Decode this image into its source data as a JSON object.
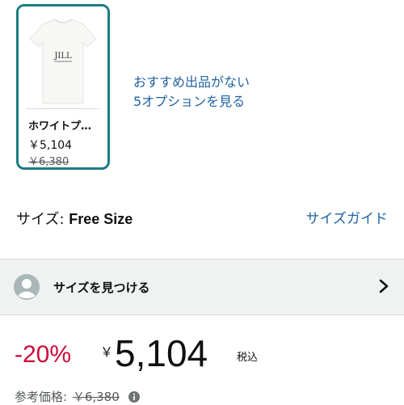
{
  "swatch": {
    "logo_text": "JILL",
    "title": "ホワイトプ…",
    "price": "￥5,104",
    "list_price": "￥6,380"
  },
  "more_options": {
    "line1": "おすすめ出品がない",
    "line2": "5オプションを見る"
  },
  "size": {
    "label": "サイズ: ",
    "value": "Free Size",
    "guide_link": "サイズガイド"
  },
  "size_finder": {
    "label": "サイズを見つける",
    "icon": "avatar-icon",
    "chevron": "chevron-right-icon"
  },
  "price": {
    "discount": "-20%",
    "currency": "￥",
    "amount": "5,104",
    "tax_note": "税込"
  },
  "reference": {
    "label": "参考価格: ",
    "price": "￥6,380",
    "icon": "info-icon"
  },
  "colors": {
    "accent_teal": "#1b7d84",
    "link_blue": "#2162a1",
    "discount_red": "#cc0c39",
    "muted_gray": "#565959"
  }
}
